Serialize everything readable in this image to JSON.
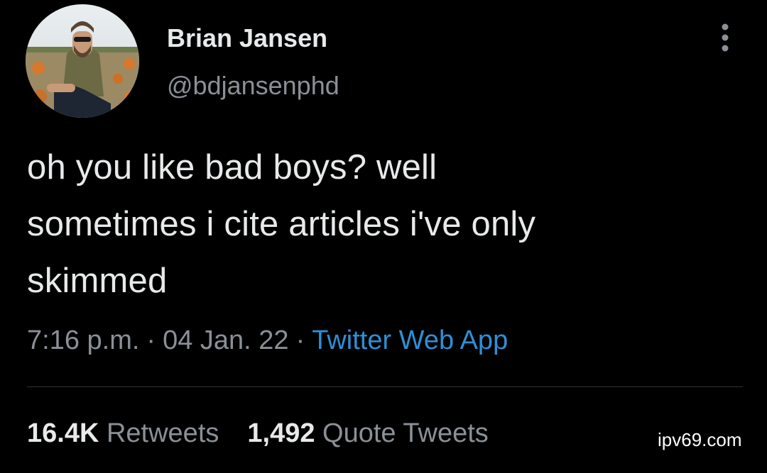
{
  "author": {
    "display_name": "Brian Jansen",
    "handle": "@bdjansenphd",
    "avatar_icon": "profile-photo"
  },
  "more_menu_icon": "more-options-icon",
  "tweet": {
    "text_lines": [
      "oh you like bad boys? well",
      "sometimes i cite articles i've only",
      "skimmed"
    ],
    "time": "7:16 p.m.",
    "separator": "·",
    "date": "04 Jan. 22",
    "source": "Twitter Web App"
  },
  "stats": {
    "retweets_count": "16.4K",
    "retweets_label": "Retweets",
    "quotes_count": "1,492",
    "quotes_label": "Quote Tweets"
  },
  "watermark": "ipv69.com",
  "colors": {
    "background": "#000000",
    "primary_text": "#e7e9ea",
    "secondary_text": "#8b9096",
    "link": "#2e8fd6"
  }
}
